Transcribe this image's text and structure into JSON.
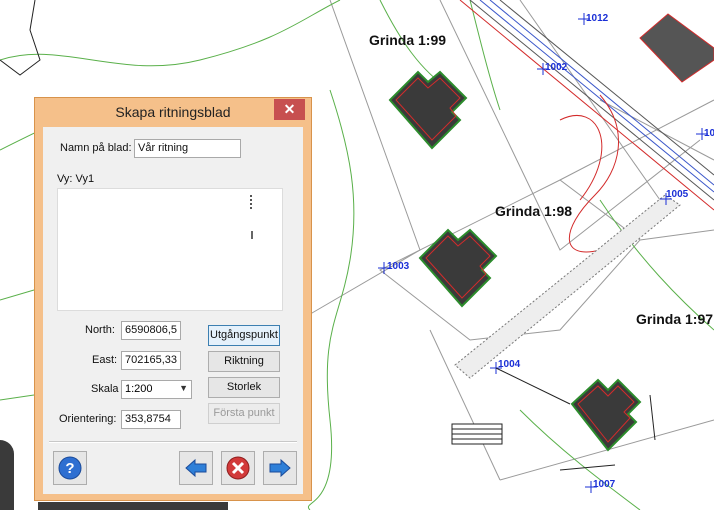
{
  "map": {
    "labels": [
      "Grinda 1:99",
      "Grinda 1:98",
      "Grinda 1:97"
    ],
    "points": [
      "1012",
      "1002",
      "1005",
      "1003",
      "1004",
      "1007",
      "10"
    ]
  },
  "dialog": {
    "title": "Skapa ritningsblad",
    "close_glyph": "✕",
    "sheet_name_label": "Namn på blad:",
    "sheet_name_value": "Vår ritning",
    "view_label": "Vy: Vy1",
    "north_label": "North:",
    "north_value": "6590806,5",
    "east_label": "East:",
    "east_value": "702165,33",
    "scale_label": "Skala",
    "scale_value": "1:200",
    "orientation_label": "Orientering:",
    "orientation_value": "353,8754",
    "buttons": {
      "start_point": "Utgångspunkt",
      "direction": "Riktning",
      "size": "Storlek",
      "first_point": "Första punkt"
    },
    "icons": {
      "help": "help-icon",
      "back": "arrow-left-icon",
      "cancel": "cancel-icon",
      "forward": "arrow-right-icon"
    },
    "colors": {
      "frame": "#f5c08a",
      "close": "#c75050",
      "accent_blue": "#1a2fd6"
    }
  }
}
